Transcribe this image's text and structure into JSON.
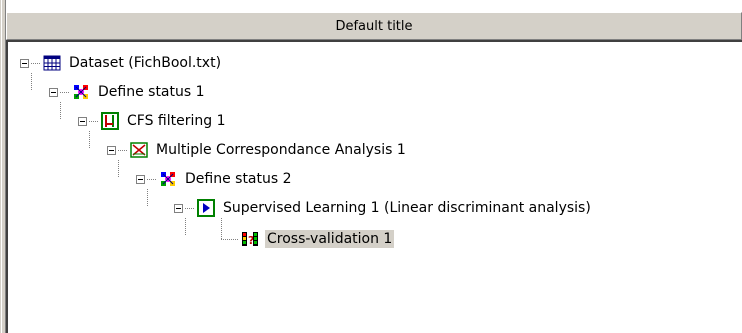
{
  "window": {
    "title": "Default title"
  },
  "tree": {
    "nodes": [
      {
        "label": "Dataset (FichBool.txt)",
        "icon": "dataset-table-icon"
      },
      {
        "label": "Define status 1",
        "icon": "define-status-icon"
      },
      {
        "label": "CFS filtering 1",
        "icon": "feature-selection-icon"
      },
      {
        "label": "Multiple Correspondance Analysis 1",
        "icon": "factorial-analysis-icon"
      },
      {
        "label": "Define status 2",
        "icon": "define-status-icon"
      },
      {
        "label": "Supervised Learning 1 (Linear discriminant analysis)",
        "icon": "supervised-learning-icon"
      },
      {
        "label": "Cross-validation 1",
        "icon": "cross-validation-icon",
        "selected": true
      }
    ]
  }
}
